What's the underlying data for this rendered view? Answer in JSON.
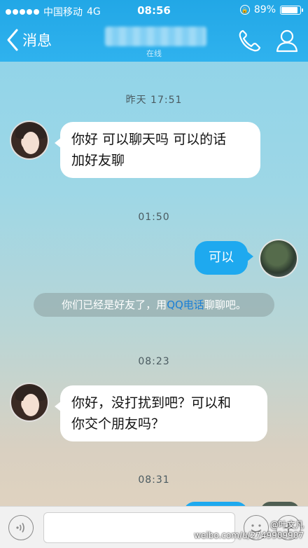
{
  "status_bar": {
    "carrier": "中国移动",
    "network": "4G",
    "time": "08:56",
    "battery": "89%",
    "battery_level": 0.89
  },
  "nav": {
    "back_label": "消息",
    "subtitle": "在线"
  },
  "messages": [
    {
      "type": "time",
      "text": "昨天 17:51"
    },
    {
      "type": "incoming",
      "lines": [
        "你好 可以聊天吗 可以的话",
        "加好友聊"
      ]
    },
    {
      "type": "time",
      "text": "01:50"
    },
    {
      "type": "outgoing",
      "text": "可以"
    },
    {
      "type": "system",
      "before": "你们已经是好友了，用",
      "link": "QQ电话",
      "after": "聊聊吧。"
    },
    {
      "type": "time",
      "text": "08:23"
    },
    {
      "type": "incoming",
      "lines": [
        "你好，没打扰到吧？可以和",
        "你交个朋友吗？"
      ]
    },
    {
      "type": "time",
      "text": "08:31"
    }
  ],
  "input": {
    "placeholder": ""
  },
  "watermark": [
    "@叶文凡",
    "weibo.com/u/2749909907"
  ],
  "colors": {
    "nav": "#22a7e6",
    "outgoing_bubble": "#1ea9ef",
    "link": "#1a7fd6"
  }
}
